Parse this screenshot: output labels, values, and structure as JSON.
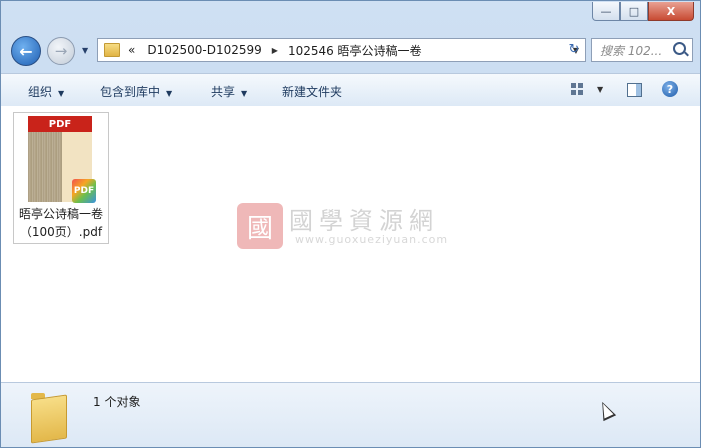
{
  "window": {
    "caption": {
      "minimize": "—",
      "maximize": "□",
      "close": "X"
    }
  },
  "nav": {
    "back_glyph": "←",
    "forward_glyph": "→",
    "address": {
      "overflow": "«",
      "segments": [
        "D102500-D102599",
        "102546 晤亭公诗稿一卷"
      ]
    },
    "refresh_glyph": "↻",
    "search_placeholder": "搜索 102..."
  },
  "toolbar": {
    "organize": "组织",
    "include_in_library": "包含到库中",
    "share": "共享",
    "new_folder": "新建文件夹",
    "help": "?"
  },
  "content": {
    "file": {
      "thumb_banner": "PDF",
      "badge": "PDF",
      "name_line1": "晤亭公诗稿一卷",
      "name_line2": "（100页）.pdf"
    },
    "watermark": {
      "seal": "國",
      "title": "國學資源網",
      "url": "www.guoxueziyuan.com"
    }
  },
  "status": {
    "text": "1 个对象"
  },
  "icons": [
    "back-icon",
    "forward-icon",
    "folder-icon",
    "refresh-icon",
    "search-icon",
    "view-options-icon",
    "preview-pane-icon",
    "help-icon",
    "pdf-icon",
    "mouse-cursor-icon"
  ]
}
